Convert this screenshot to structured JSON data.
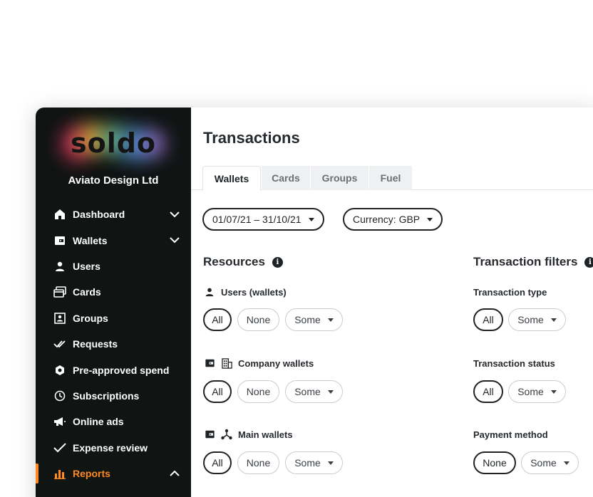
{
  "sidebar": {
    "logo_text": "soldo",
    "company": "Aviato Design Ltd",
    "items": [
      {
        "label": "Dashboard",
        "icon": "home-icon",
        "chevron": "down"
      },
      {
        "label": "Wallets",
        "icon": "wallet-icon",
        "chevron": "down"
      },
      {
        "label": "Users",
        "icon": "user-icon"
      },
      {
        "label": "Cards",
        "icon": "cards-icon"
      },
      {
        "label": "Groups",
        "icon": "groups-icon"
      },
      {
        "label": "Requests",
        "icon": "double-check-icon"
      },
      {
        "label": "Pre-approved spend",
        "icon": "hexagon-icon"
      },
      {
        "label": "Subscriptions",
        "icon": "clock-icon"
      },
      {
        "label": "Online ads",
        "icon": "megaphone-icon"
      },
      {
        "label": "Expense review",
        "icon": "check-icon"
      },
      {
        "label": "Reports",
        "icon": "bar-chart-icon",
        "chevron": "up",
        "active": true
      }
    ]
  },
  "main": {
    "title": "Transactions",
    "tabs": [
      "Wallets",
      "Cards",
      "Groups",
      "Fuel"
    ],
    "active_tab": "Wallets",
    "date_range": "01/07/21 – 31/10/21",
    "currency": "Currency: GBP",
    "resources": {
      "title": "Resources",
      "groups": [
        {
          "label": "Users (wallets)",
          "selected": "All"
        },
        {
          "label": "Company wallets",
          "selected": "All"
        },
        {
          "label": "Main wallets",
          "selected": "All"
        }
      ]
    },
    "filters": {
      "title": "Transaction filters",
      "groups": [
        {
          "label": "Transaction type",
          "selected": "All"
        },
        {
          "label": "Transaction status",
          "selected": "All"
        },
        {
          "label": "Payment method",
          "selected": "None"
        }
      ]
    },
    "chip_all": "All",
    "chip_none": "None",
    "chip_some": "Some"
  },
  "colors": {
    "sidebar_bg": "#101413",
    "accent": "#ff8a1f",
    "text_dark": "#1f2326"
  }
}
